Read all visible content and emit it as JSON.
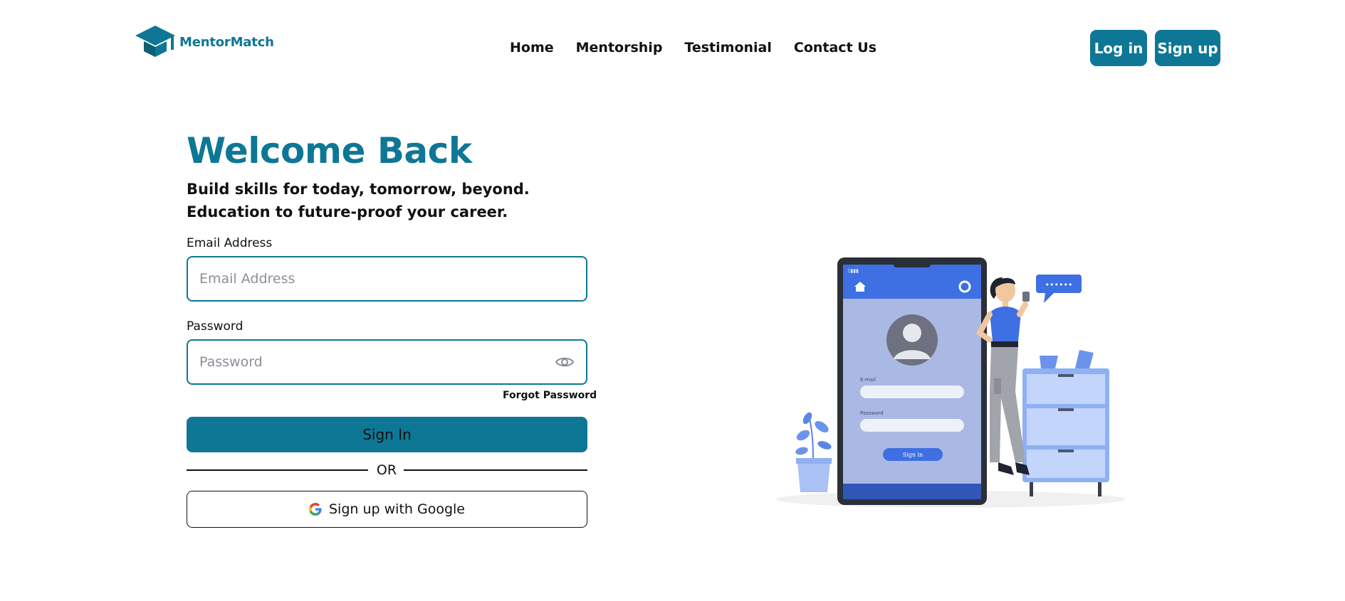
{
  "brand": {
    "name": "MentorMatch",
    "color": "#0e7795"
  },
  "nav": {
    "items": [
      {
        "label": "Home"
      },
      {
        "label": "Mentorship"
      },
      {
        "label": "Testimonial"
      },
      {
        "label": "Contact Us"
      }
    ]
  },
  "header": {
    "login_label": "Log in",
    "signup_label": "Sign up"
  },
  "hero": {
    "title": "Welcome Back",
    "tagline_1": "Build skills for today, tomorrow, beyond.",
    "tagline_2": "Education to future-proof your career."
  },
  "form": {
    "email_label": "Email Address",
    "email_placeholder": "Email Address",
    "email_value": "",
    "password_label": "Password",
    "password_placeholder": "Password",
    "password_value": "",
    "forgot_label": "Forgot Password",
    "signin_label": "Sign In",
    "or_label": "OR",
    "google_label": "Sign up with Google"
  },
  "illustration": {
    "phone_email_label": "E-mail",
    "phone_password_label": "Password",
    "phone_signin_label": "Sign in",
    "phone_status": "Ξ▮▮▮",
    "bubble_text": "••••••"
  },
  "icons": [
    "graduation-cap-icon",
    "eye-icon",
    "google-icon",
    "home-icon",
    "gear-icon",
    "user-avatar-icon"
  ]
}
